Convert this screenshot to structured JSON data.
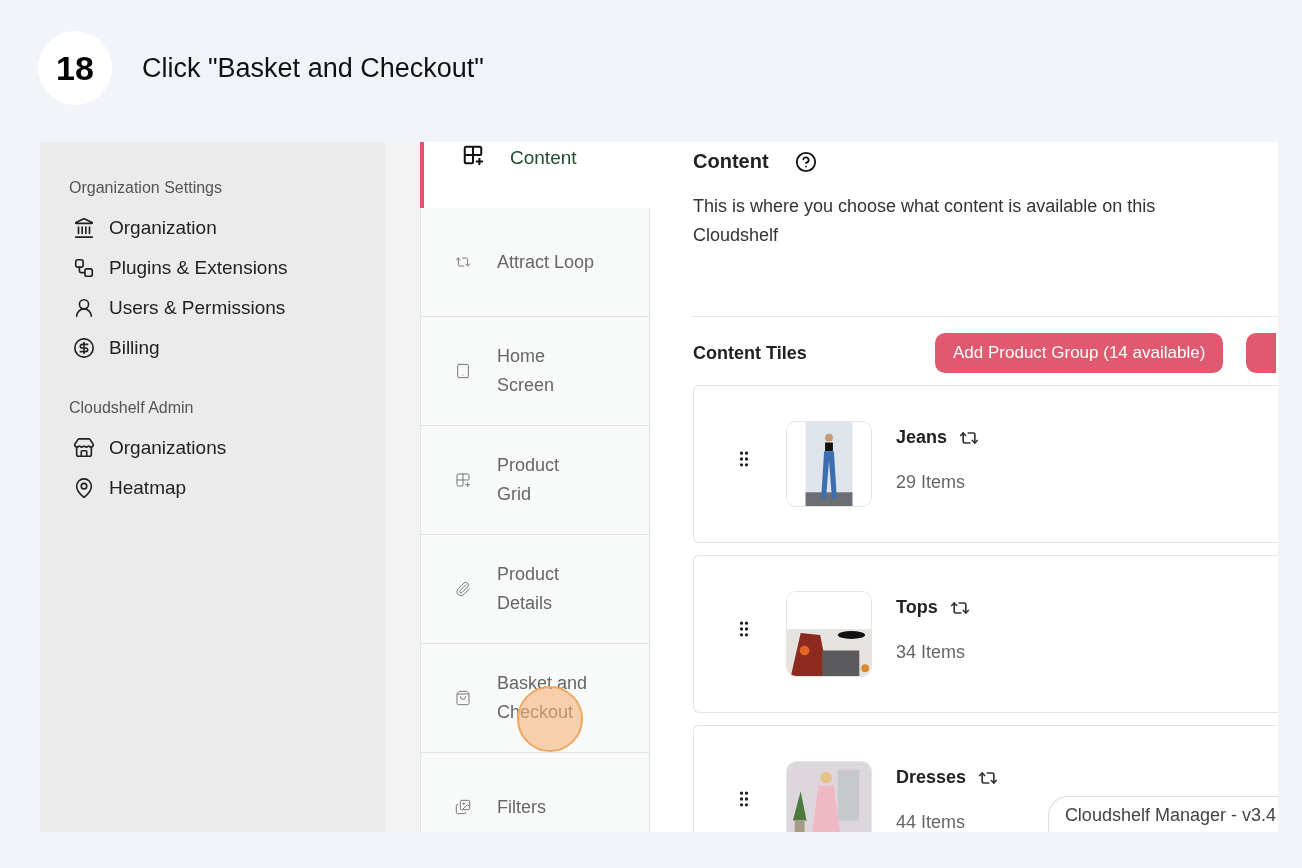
{
  "step": {
    "number": "18",
    "instruction": "Click \"Basket and Checkout\""
  },
  "sidebar": {
    "sections": [
      {
        "title": "Organization Settings",
        "items": [
          {
            "label": "Organization"
          },
          {
            "label": "Plugins & Extensions"
          },
          {
            "label": "Users & Permissions"
          },
          {
            "label": "Billing"
          }
        ]
      },
      {
        "title": "Cloudshelf Admin",
        "items": [
          {
            "label": "Organizations"
          },
          {
            "label": "Heatmap"
          }
        ]
      }
    ]
  },
  "tabs": [
    {
      "label": "Content",
      "selected": true,
      "clicked": false
    },
    {
      "label": "Attract Loop",
      "selected": false,
      "clicked": false
    },
    {
      "label": "Home Screen",
      "selected": false,
      "clicked": false
    },
    {
      "label": "Product Grid",
      "selected": false,
      "clicked": false
    },
    {
      "label": "Product Details",
      "selected": false,
      "clicked": false
    },
    {
      "label": "Basket and Checkout",
      "selected": false,
      "clicked": true
    },
    {
      "label": "Filters",
      "selected": false,
      "clicked": false
    }
  ],
  "content": {
    "title": "Content",
    "description": "This is where you choose what content is available on this Cloudshelf",
    "tiles_title": "Content Tiles",
    "add_button": "Add Product Group (14 available)",
    "tiles": [
      {
        "name": "Jeans",
        "count": "29 Items"
      },
      {
        "name": "Tops",
        "count": "34 Items"
      },
      {
        "name": "Dresses",
        "count": "44 Items"
      }
    ]
  },
  "version": "Cloudshelf Manager - v3.4"
}
